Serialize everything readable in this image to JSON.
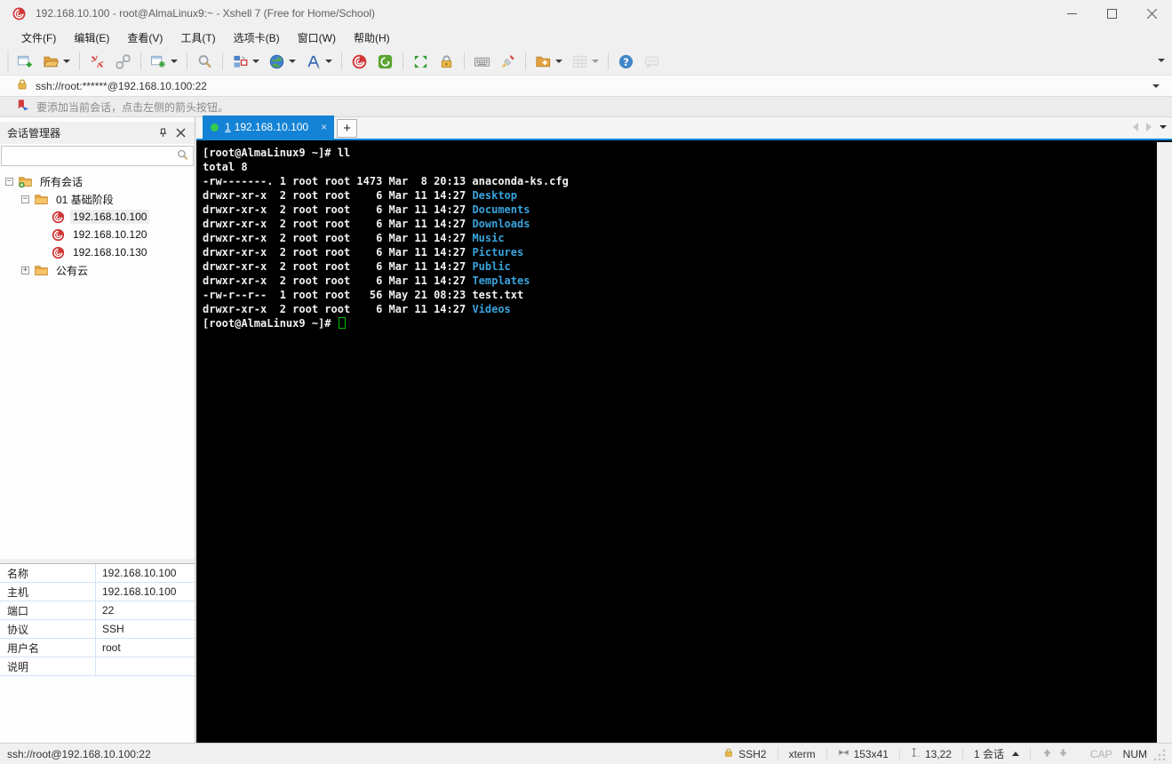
{
  "colors": {
    "tab_active": "#1583d5",
    "tab_dot": "#33cc4e",
    "terminal_background": "#000000",
    "terminal_text": "#f2f2f2",
    "terminal_directory": "#3aa3dc",
    "cursor": "#00c000",
    "session_icon": "#cf3535",
    "folder_icon": "#e9a73e"
  },
  "window": {
    "title": "192.168.10.100 - root@AlmaLinux9:~ - Xshell 7 (Free for Home/School)"
  },
  "menu": {
    "items": [
      "文件(F)",
      "编辑(E)",
      "查看(V)",
      "工具(T)",
      "选项卡(B)",
      "窗口(W)",
      "帮助(H)"
    ]
  },
  "toolbar": {
    "items": [
      {
        "name": "new-session"
      },
      {
        "name": "open-folder",
        "dropdown": true
      },
      {
        "sep": true
      },
      {
        "name": "disconnect"
      },
      {
        "name": "reconnect"
      },
      {
        "sep": true
      },
      {
        "name": "session-properties",
        "dropdown": true
      },
      {
        "sep": true
      },
      {
        "name": "find"
      },
      {
        "sep": true
      },
      {
        "name": "tab-layout",
        "dropdown": true
      },
      {
        "name": "web-browser",
        "dropdown": true
      },
      {
        "name": "font",
        "dropdown": true
      },
      {
        "sep": true
      },
      {
        "name": "xshell"
      },
      {
        "name": "xftp"
      },
      {
        "sep": true
      },
      {
        "name": "fullscreen"
      },
      {
        "name": "lock-screen"
      },
      {
        "sep": true
      },
      {
        "name": "virtual-keyboard"
      },
      {
        "name": "clear-screen"
      },
      {
        "sep": true
      },
      {
        "name": "new-file",
        "dropdown": true
      },
      {
        "name": "matrix-view",
        "dropdown": true,
        "disabled": true
      },
      {
        "sep": true
      },
      {
        "name": "help"
      },
      {
        "name": "quick-commands",
        "disabled": true
      }
    ]
  },
  "address_bar": {
    "url": "ssh://root:******@192.168.10.100:22"
  },
  "info_bar": {
    "message": "要添加当前会话，点击左侧的箭头按钮。"
  },
  "session_manager": {
    "title": "会话管理器",
    "search_value": "",
    "tree": [
      {
        "label": "所有会话",
        "type": "root-folder",
        "level": 0,
        "expander": "minus",
        "icon": "folder-root"
      },
      {
        "label": "01 基础阶段",
        "type": "folder",
        "level": 1,
        "expander": "minus",
        "icon": "folder"
      },
      {
        "label": "192.168.10.100",
        "type": "session",
        "level": 2,
        "icon": "session",
        "selected": true
      },
      {
        "label": "192.168.10.120",
        "type": "session",
        "level": 2,
        "icon": "session"
      },
      {
        "label": "192.168.10.130",
        "type": "session",
        "level": 2,
        "icon": "session"
      },
      {
        "label": "公有云",
        "type": "folder",
        "level": 1,
        "expander": "plus",
        "icon": "folder"
      }
    ],
    "properties": [
      {
        "label": "名称",
        "value": "192.168.10.100"
      },
      {
        "label": "主机",
        "value": "192.168.10.100"
      },
      {
        "label": "端口",
        "value": "22"
      },
      {
        "label": "协议",
        "value": "SSH"
      },
      {
        "label": "用户名",
        "value": "root"
      },
      {
        "label": "说明",
        "value": ""
      }
    ]
  },
  "tab_bar": {
    "active_tab": {
      "index": "1",
      "title": "192.168.10.100",
      "close": "×"
    },
    "new_tab": "+"
  },
  "terminal": {
    "lines": [
      {
        "segs": [
          {
            "t": "[root@AlmaLinux9 ~]# ll",
            "s": "p"
          }
        ]
      },
      {
        "segs": [
          {
            "t": "total 8",
            "s": "p"
          }
        ]
      },
      {
        "segs": [
          {
            "t": "-rw-------. 1 root root 1473 Mar  8 20:13 anaconda-ks.cfg",
            "s": "p"
          }
        ]
      },
      {
        "segs": [
          {
            "t": "drwxr-xr-x  2 root root    6 Mar 11 14:27 ",
            "s": "p"
          },
          {
            "t": "Desktop",
            "s": "d"
          }
        ]
      },
      {
        "segs": [
          {
            "t": "drwxr-xr-x  2 root root    6 Mar 11 14:27 ",
            "s": "p"
          },
          {
            "t": "Documents",
            "s": "d"
          }
        ]
      },
      {
        "segs": [
          {
            "t": "drwxr-xr-x  2 root root    6 Mar 11 14:27 ",
            "s": "p"
          },
          {
            "t": "Downloads",
            "s": "d"
          }
        ]
      },
      {
        "segs": [
          {
            "t": "drwxr-xr-x  2 root root    6 Mar 11 14:27 ",
            "s": "p"
          },
          {
            "t": "Music",
            "s": "d"
          }
        ]
      },
      {
        "segs": [
          {
            "t": "drwxr-xr-x  2 root root    6 Mar 11 14:27 ",
            "s": "p"
          },
          {
            "t": "Pictures",
            "s": "d"
          }
        ]
      },
      {
        "segs": [
          {
            "t": "drwxr-xr-x  2 root root    6 Mar 11 14:27 ",
            "s": "p"
          },
          {
            "t": "Public",
            "s": "d"
          }
        ]
      },
      {
        "segs": [
          {
            "t": "drwxr-xr-x  2 root root    6 Mar 11 14:27 ",
            "s": "p"
          },
          {
            "t": "Templates",
            "s": "d"
          }
        ]
      },
      {
        "segs": [
          {
            "t": "-rw-r--r--  1 root root   56 May 21 08:23 test.txt",
            "s": "p"
          }
        ]
      },
      {
        "segs": [
          {
            "t": "drwxr-xr-x  2 root root    6 Mar 11 14:27 ",
            "s": "p"
          },
          {
            "t": "Videos",
            "s": "d"
          }
        ]
      },
      {
        "segs": [
          {
            "t": "[root@AlmaLinux9 ~]# ",
            "s": "p"
          }
        ],
        "cursor": true
      }
    ]
  },
  "status_bar": {
    "connection": "ssh://root@192.168.10.100:22",
    "encryption": "SSH2",
    "terminal_type": "xterm",
    "screen_size": "153x41",
    "cursor_position": "13,22",
    "session_count": "1 会话",
    "caps_indicator": "CAP",
    "num_indicator": "NUM"
  }
}
